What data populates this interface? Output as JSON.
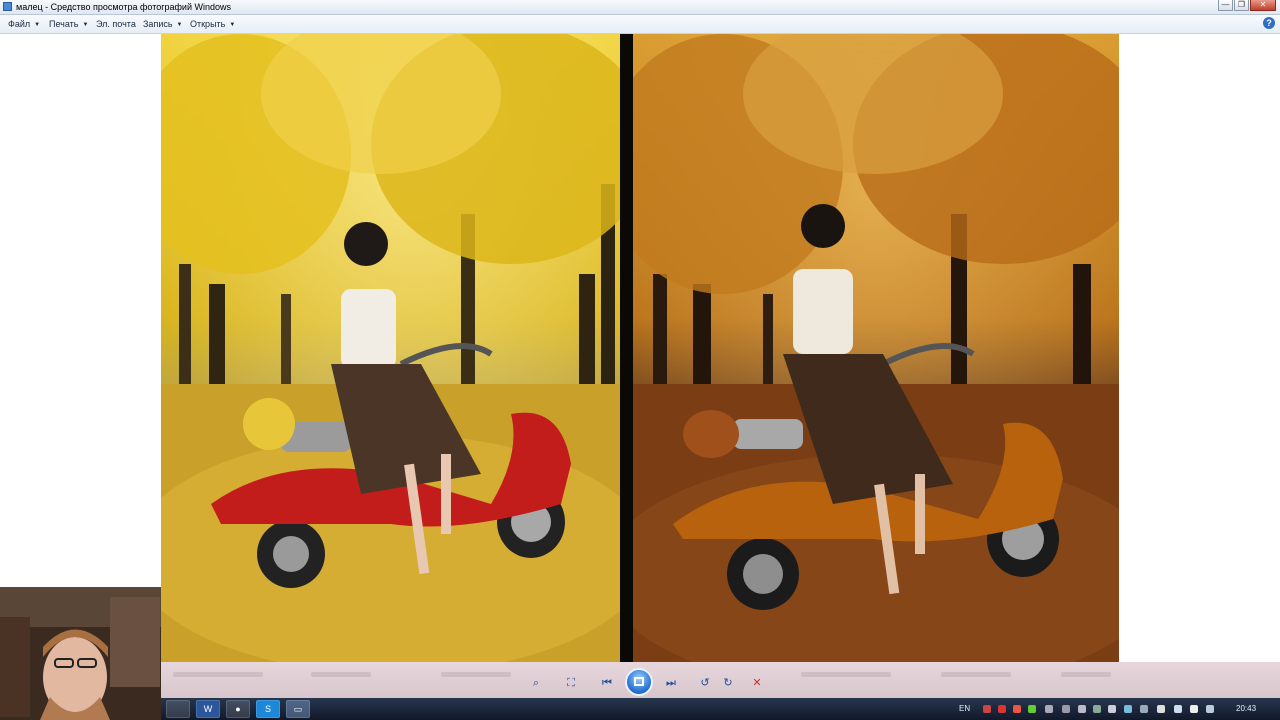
{
  "window": {
    "title": "малец - Средство просмотра фотографий Windows",
    "controls": [
      "—",
      "❐",
      "✕"
    ]
  },
  "menu": {
    "items": [
      {
        "label": "Файл",
        "has_arrow": true
      },
      {
        "label": "Печать",
        "has_arrow": true
      },
      {
        "label": "Эл. почта",
        "has_arrow": false
      },
      {
        "label": "Запись",
        "has_arrow": true
      },
      {
        "label": "Открыть",
        "has_arrow": true
      }
    ],
    "help": "?"
  },
  "photos": {
    "left": {
      "palette": {
        "sky": "#e8c330",
        "foliage": "#d8b21c",
        "ground": "#c9a12a",
        "trunk": "#3b2f17",
        "scooter": "#c21d1b"
      }
    },
    "right": {
      "palette": {
        "sky": "#d0902a",
        "foliage": "#b8701a",
        "ground": "#7a3d14",
        "trunk": "#2a1a0e",
        "scooter": "#b8620d"
      }
    }
  },
  "controls": {
    "zoom": "⌕",
    "fit": "⛶",
    "prev": "⏮",
    "next": "⏭",
    "rotate_ccw": "↺",
    "rotate_cw": "↻",
    "delete": "✕"
  },
  "taskbar": {
    "apps": [
      "",
      "W",
      "●",
      "S",
      "▭"
    ],
    "language": "EN",
    "clock": "20:43"
  }
}
